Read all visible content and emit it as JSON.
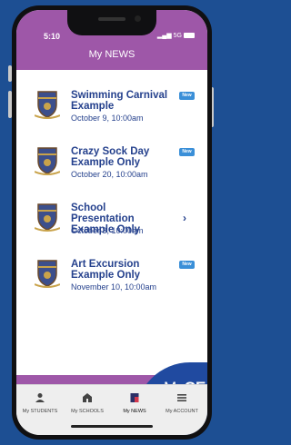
{
  "status_bar": {
    "time": "5:10",
    "network": "5G"
  },
  "header": {
    "title": "My NEWS"
  },
  "news": [
    {
      "title_lines": [
        "Swimming Carnival",
        "Example"
      ],
      "date": "October 9, 10:00am",
      "badge": "New"
    },
    {
      "title_lines": [
        "Crazy Sock Day",
        "Example Only"
      ],
      "date": "October 20, 10:00am",
      "badge": "New"
    },
    {
      "title_lines": [
        "School Presentation",
        "Example Only"
      ],
      "date": "October 3, 10:00am",
      "badge": ""
    },
    {
      "title_lines": [
        "Art Excursion",
        "Example Only"
      ],
      "date": "November 10, 10:00am",
      "badge": "New"
    }
  ],
  "brand": {
    "prefix": "My",
    "suffix": "CE"
  },
  "tabs": [
    {
      "label": "My STUDENTS",
      "icon": "person-icon"
    },
    {
      "label": "My SCHOOLS",
      "icon": "school-icon"
    },
    {
      "label": "My NEWS",
      "icon": "news-icon",
      "active": true
    },
    {
      "label": "My ACCOUNT",
      "icon": "menu-icon"
    }
  ],
  "colors": {
    "background": "#1d4f93",
    "header": "#9e57a8",
    "text": "#25418d",
    "badge": "#3a8fd8",
    "brand": "#204aa0"
  }
}
